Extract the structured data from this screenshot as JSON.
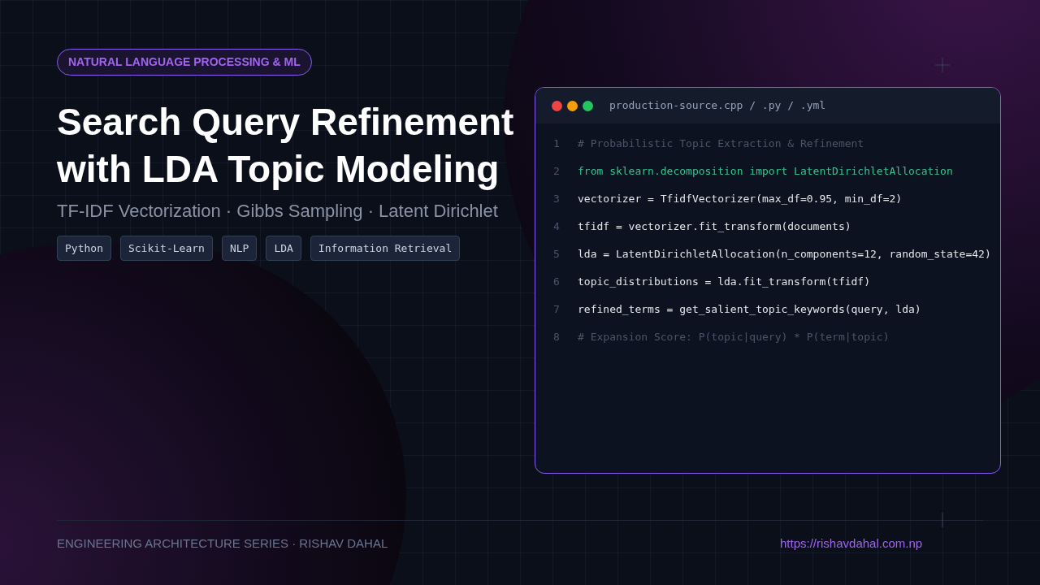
{
  "badge": "NATURAL LANGUAGE PROCESSING & ML",
  "title_lines": [
    "Search Query Refinement",
    "with LDA Topic Modeling"
  ],
  "subtitle": "TF-IDF Vectorization · Gibbs Sampling · Latent Dirichlet",
  "tags": [
    "Python",
    "Scikit-Learn",
    "NLP",
    "LDA",
    "Information Retrieval"
  ],
  "code_window": {
    "filename": "production-source.cpp / .py / .yml",
    "lines": [
      {
        "number": "1",
        "kind": "comment",
        "text": "# Probabilistic Topic Extraction & Refinement"
      },
      {
        "number": "2",
        "kind": "import",
        "text": "from sklearn.decomposition import LatentDirichletAllocation"
      },
      {
        "number": "3",
        "kind": "code",
        "text": "vectorizer = TfidfVectorizer(max_df=0.95, min_df=2)"
      },
      {
        "number": "4",
        "kind": "code",
        "text": "tfidf = vectorizer.fit_transform(documents)"
      },
      {
        "number": "5",
        "kind": "code",
        "text": "lda = LatentDirichletAllocation(n_components=12, random_state=42)"
      },
      {
        "number": "6",
        "kind": "code",
        "text": "topic_distributions = lda.fit_transform(tfidf)"
      },
      {
        "number": "7",
        "kind": "code",
        "text": "refined_terms = get_salient_topic_keywords(query, lda)"
      },
      {
        "number": "8",
        "kind": "comment",
        "text": "# Expansion Score: P(topic|query) * P(term|topic)"
      }
    ]
  },
  "footer": {
    "series": "ENGINEERING ARCHITECTURE SERIES · RISHAV DAHAL",
    "link": "https://rishavdahal.com.np"
  }
}
